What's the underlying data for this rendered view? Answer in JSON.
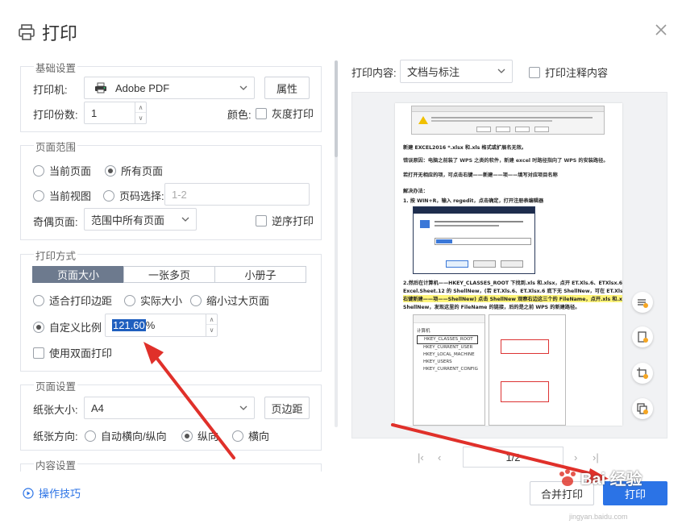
{
  "dialog": {
    "title": "打印",
    "accent": "#2b73e6"
  },
  "basic": {
    "legend": "基础设置",
    "printer_label": "打印机:",
    "printer_value": "Adobe PDF",
    "properties_button": "属性",
    "copies_label": "打印份数:",
    "copies_value": "1",
    "color_label": "颜色:",
    "grayscale_label": "灰度打印"
  },
  "range": {
    "legend": "页面范围",
    "current_page": "当前页面",
    "all_pages": "所有页面",
    "current_view": "当前视图",
    "page_select": "页码选择:",
    "page_select_placeholder": "1-2",
    "odd_even_label": "奇偶页面:",
    "odd_even_value": "范围中所有页面",
    "reverse_label": "逆序打印"
  },
  "mode": {
    "legend": "打印方式",
    "tabs": [
      "页面大小",
      "一张多页",
      "小册子"
    ],
    "fit_margin": "适合打印边距",
    "actual_size": "实际大小",
    "shrink_large": "缩小过大页面",
    "custom_scale": "自定义比例",
    "scale_value": "121.60",
    "scale_unit": "%",
    "duplex_label": "使用双面打印"
  },
  "page_setup": {
    "legend": "页面设置",
    "paper_label": "纸张大小:",
    "paper_value": "A4",
    "margin_button": "页边距",
    "orientation_label": "纸张方向:",
    "auto": "自动横向/纵向",
    "portrait": "纵向",
    "landscape": "横向"
  },
  "content": {
    "legend": "内容设置"
  },
  "tips_label": "操作技巧",
  "preview": {
    "content_label": "打印内容:",
    "content_value": "文档与标注",
    "print_annotations": "打印注释内容",
    "pager_text": "1/2",
    "doc_lines": [
      "新建 EXCEL2016 *.xlsx 和.xls 格式或扩展名无效。",
      "错误原因：电脑之前装了 WPS 之类的软件，新建 excel 时路径指向了 WPS 的安装路径。",
      "若打开无相应的项，可点击右键——新建——项——填写对应项目名称",
      "解决办法：",
      "1. 按 WIN+R，输入 regedit，点击确定，打开注册表编辑器",
      "2.然后在计算机——HKEY_CLASSES_ROOT 下找到.xls 和.xlsx，点开 ET.Xls.6、ETXlsx.6 与",
      "Excel.Sheet.12 的 ShellNew，(若 ET.Xls.6、ET.Xlsx.6 底下无 ShellNew，可在 ET.Xls.6、ET.Xlsx.6",
      "右键新建——项——ShellNew) 点击 ShellNew 观察右边这三个的 FileName，点开.xls 和.xlsx 的",
      "ShellNew，发现这里的 FileName 的链接，后的是之前 WPS 的新建路径。"
    ],
    "regedit_items": [
      "计算机",
      "HKEY_CLASSES_ROOT",
      "HKEY_CURRENT_USER",
      "HKEY_LOCAL_MACHINE",
      "HKEY_USERS",
      "HKEY_CURRENT_CONFIG"
    ]
  },
  "footer": {
    "merge_print": "合并打印",
    "print": "打印"
  },
  "watermark": "Bai 经验",
  "watermark_url": "jingyan.baidu.com"
}
